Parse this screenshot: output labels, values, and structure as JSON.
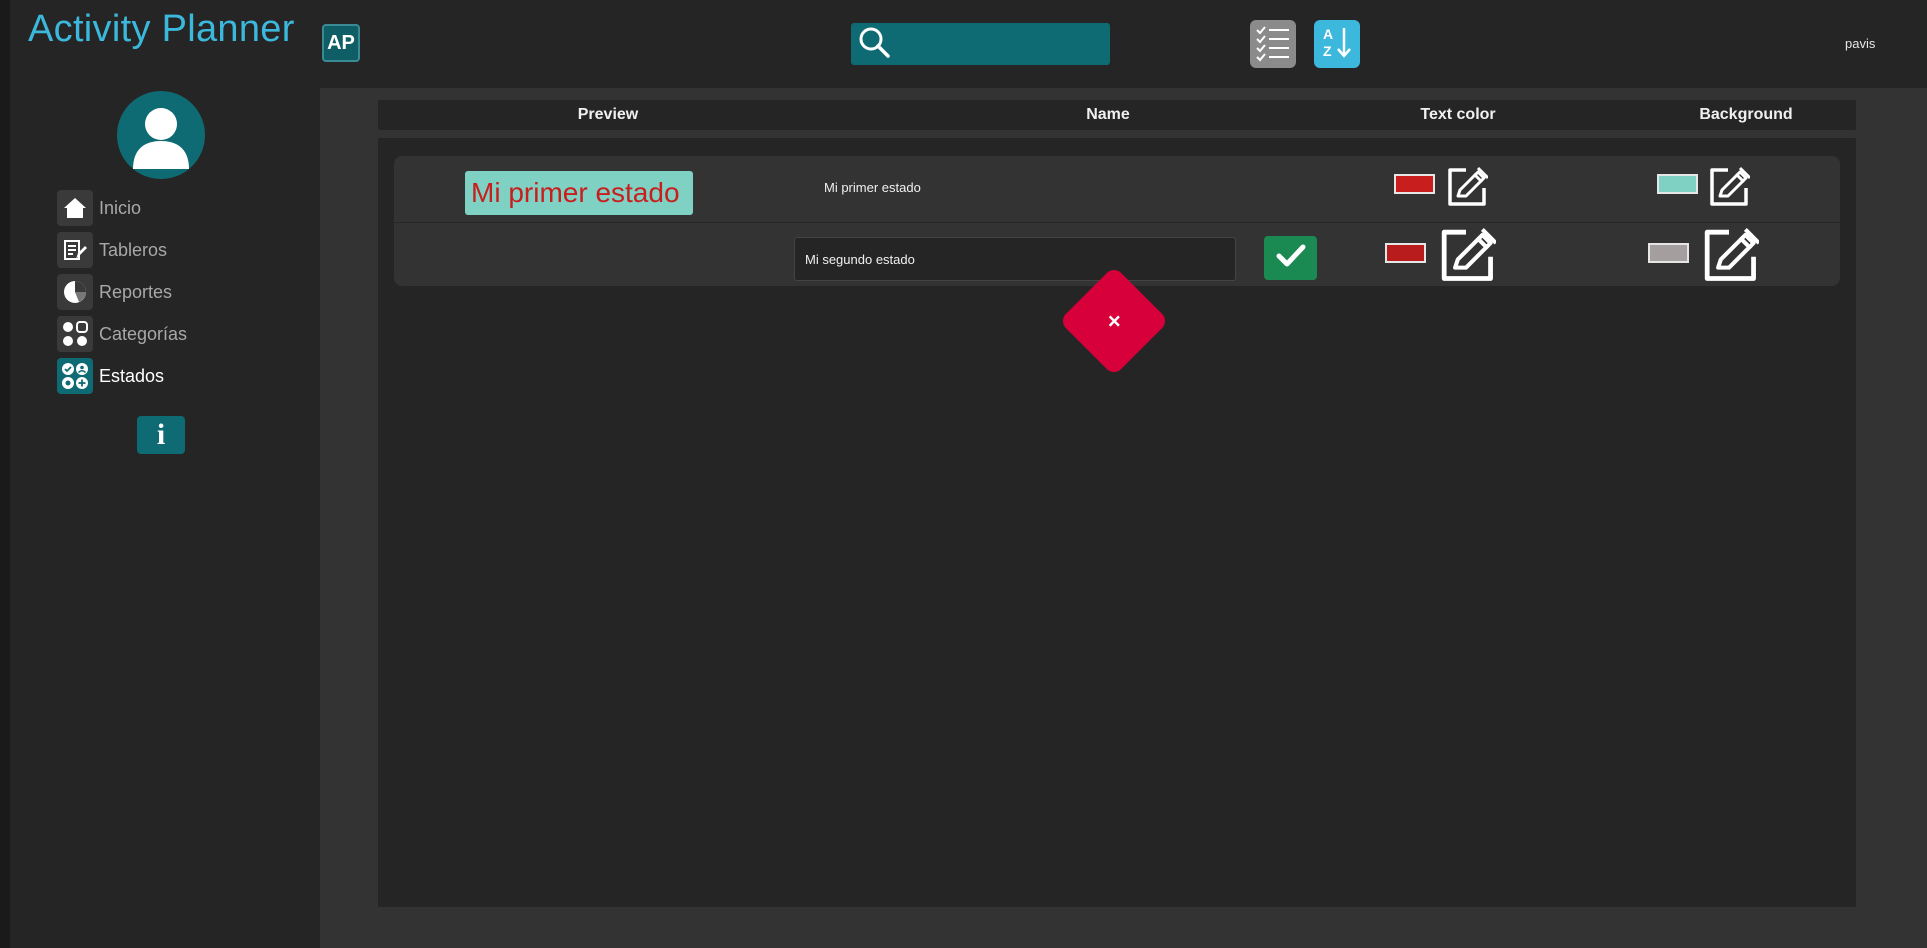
{
  "app": {
    "title": "Activity Planner",
    "logo_text": "AP",
    "user_name": "pavis"
  },
  "search": {
    "value": "",
    "placeholder": ""
  },
  "sidebar": {
    "items": [
      {
        "label": "Inicio",
        "icon": "home-icon",
        "active": false
      },
      {
        "label": "Tableros",
        "icon": "board-edit-icon",
        "active": false
      },
      {
        "label": "Reportes",
        "icon": "pie-chart-icon",
        "active": false
      },
      {
        "label": "Categorías",
        "icon": "categories-icon",
        "active": false
      },
      {
        "label": "Estados",
        "icon": "states-icon",
        "active": true
      }
    ],
    "info_label": "i"
  },
  "table": {
    "headers": [
      "Preview",
      "Name",
      "Text color",
      "Background"
    ],
    "rows": [
      {
        "preview": "Mi primer estado",
        "name": "Mi primer estado",
        "text_color": "#c81e1e",
        "background_color": "#7fd1c4",
        "editing": false
      },
      {
        "preview": "",
        "name": "Mi segundo estado",
        "text_color": "#b81c1c",
        "background_color": "#a59e9e",
        "editing": true
      }
    ]
  },
  "delete_button": {
    "label": "×"
  },
  "colors": {
    "accent": "#3bb8dc",
    "teal": "#0f6b73",
    "confirm": "#1a8a52",
    "delete": "#d8003a"
  }
}
